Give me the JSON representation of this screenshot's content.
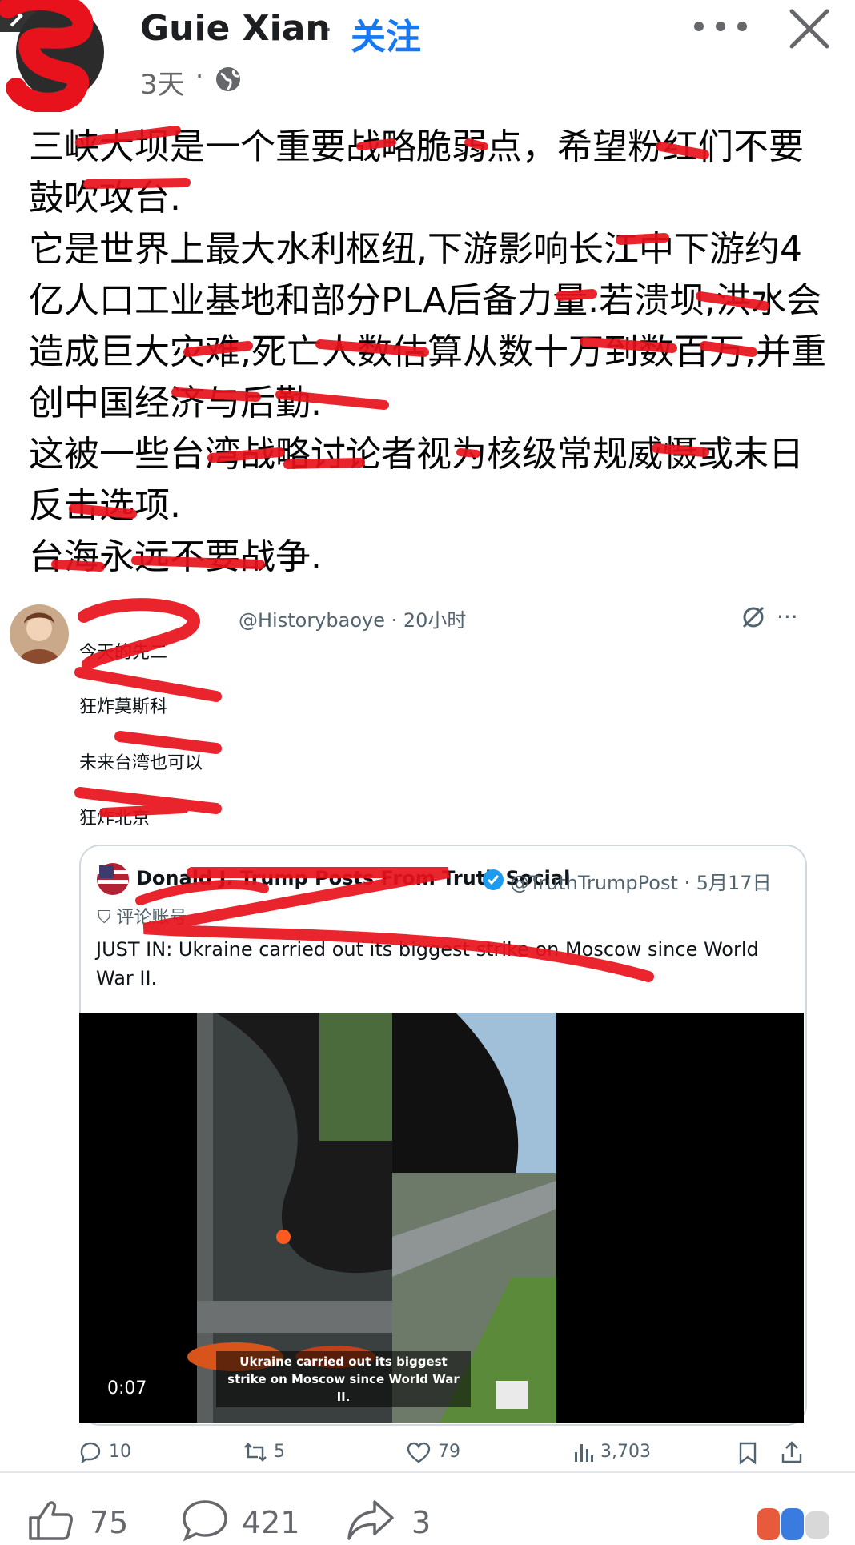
{
  "header": {
    "author": "Guie Xian",
    "separator": "·",
    "follow_label": "关注",
    "time": "3天",
    "time_separator": "·"
  },
  "post": {
    "lines": [
      "三峡大坝是一个重要战略脆弱点，希望粉红们不要鼓吹攻台.",
      "它是世界上最大水利枢纽,下游影响长江中下游约4亿人口工业基地和部分PLA后备力量.若溃坝,洪水会造成巨大灾难,死亡人数估算从数十万到数百万,并重创中国经济与后勤.",
      "这被一些台湾战略讨论者视为核级常规威慑或末日反击选项.",
      "台海永远不要战争."
    ]
  },
  "tweet": {
    "handle": "@Historybaoye · 20小时",
    "more": "···",
    "lines": [
      "今天的先二",
      "狂炸莫斯科",
      "未来台湾也可以",
      "狂炸北京"
    ],
    "quote": {
      "name": "Donald J. Trump Posts From Truth Social",
      "handle": "@TruthTrumpPost · 5月17日",
      "label": "评论账号",
      "text": "JUST IN: Ukraine carried out its biggest strike on Moscow since World War II.",
      "video_caption": "Ukraine carried out its biggest strike on Moscow since World War II.",
      "video_time": "0:07"
    },
    "actions": {
      "replies": "10",
      "retweets": "5",
      "likes": "79",
      "views": "3,703"
    }
  },
  "footer": {
    "likes": "75",
    "comments": "421",
    "shares": "3"
  },
  "colors": {
    "facebook_blue": "#1877f2",
    "scribble_red": "#e8121c",
    "muted": "#65676b"
  }
}
